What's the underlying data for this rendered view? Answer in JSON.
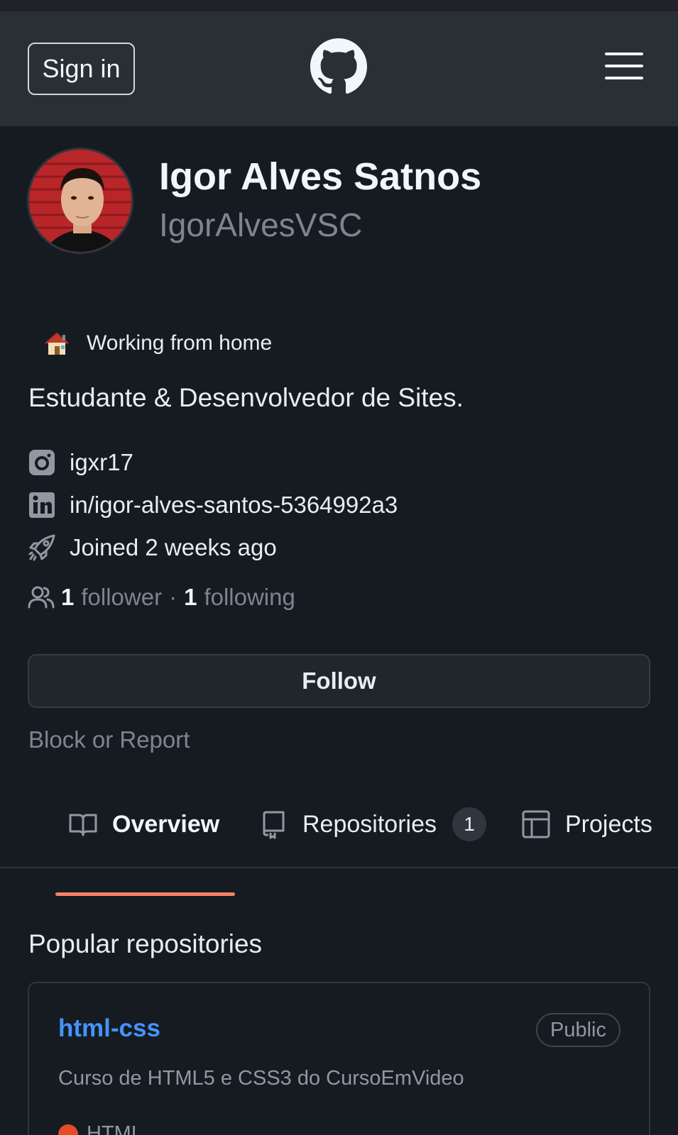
{
  "header": {
    "sign_in_label": "Sign in"
  },
  "profile": {
    "name": "Igor Alves Satnos",
    "login": "IgorAlvesVSC",
    "status": "Working from home",
    "bio": "Estudante & Desenvolvedor de Sites.",
    "instagram": "igxr17",
    "linkedin": "in/igor-alves-santos-5364992a3",
    "joined": "Joined 2 weeks ago",
    "followers_count": "1",
    "followers_label": "follower",
    "separator": "·",
    "following_count": "1",
    "following_label": "following",
    "follow_button": "Follow",
    "block_link": "Block or Report"
  },
  "tabs": [
    {
      "label": "Overview",
      "icon": "book-icon",
      "active": true
    },
    {
      "label": "Repositories",
      "icon": "repo-icon",
      "count": "1"
    },
    {
      "label": "Projects",
      "icon": "table-icon"
    }
  ],
  "popular": {
    "title": "Popular repositories",
    "repos": [
      {
        "name": "html-css",
        "visibility": "Public",
        "description": "Curso de HTML5 e CSS3 do CursoEmVideo",
        "language": "HTML",
        "language_color": "#e34c26"
      }
    ]
  },
  "colors": {
    "accent_link": "#4493f8",
    "tab_underline": "#f78166"
  }
}
